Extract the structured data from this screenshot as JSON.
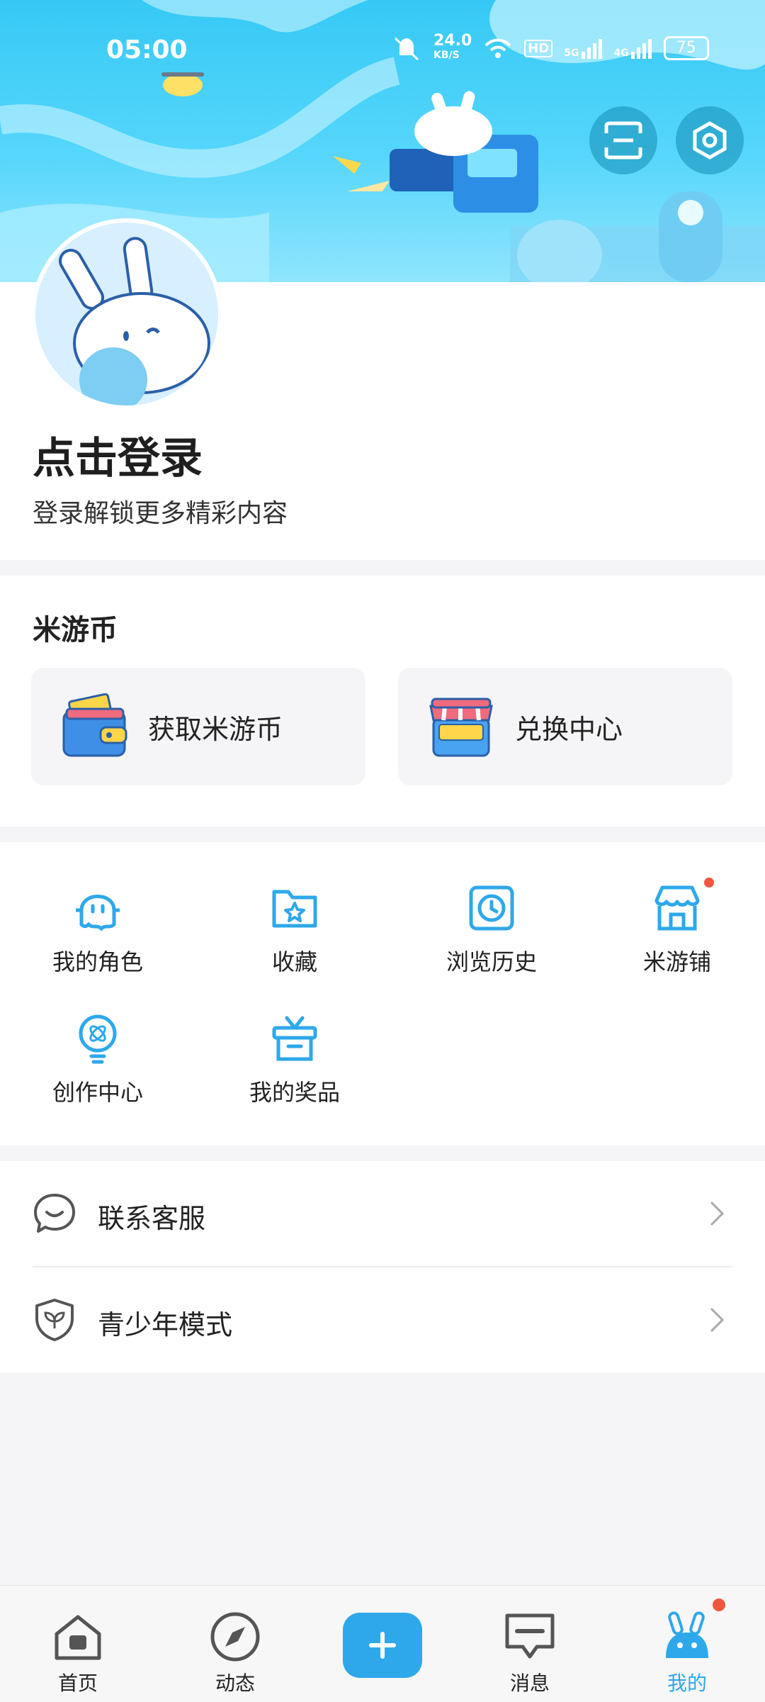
{
  "status_bar": {
    "time": "05:00",
    "net_speed": "24.0",
    "net_speed_unit": "KB/S",
    "hd_label": "HD",
    "signal_5g": "5G",
    "signal_4g": "4G",
    "battery": "75"
  },
  "profile": {
    "login_title": "点击登录",
    "login_subtitle": "登录解锁更多精彩内容"
  },
  "coin": {
    "section_title": "米游币",
    "cards": [
      {
        "label": "获取米游币",
        "icon": "wallet-icon"
      },
      {
        "label": "兑换中心",
        "icon": "shop-stall-icon"
      }
    ]
  },
  "shortcuts": [
    {
      "label": "我的角色",
      "icon": "character-icon"
    },
    {
      "label": "收藏",
      "icon": "star-folder-icon"
    },
    {
      "label": "浏览历史",
      "icon": "clock-icon"
    },
    {
      "label": "米游铺",
      "icon": "store-icon",
      "badge": true
    },
    {
      "label": "创作中心",
      "icon": "bulb-icon"
    },
    {
      "label": "我的奖品",
      "icon": "gift-icon"
    }
  ],
  "menu": [
    {
      "label": "联系客服",
      "icon": "chat-face-icon"
    },
    {
      "label": "青少年模式",
      "icon": "shield-leaf-icon"
    }
  ],
  "bottom_nav": [
    {
      "label": "首页",
      "icon": "home-icon"
    },
    {
      "label": "动态",
      "icon": "compass-icon"
    },
    {
      "label": "",
      "icon": "plus-icon"
    },
    {
      "label": "消息",
      "icon": "message-icon"
    },
    {
      "label": "我的",
      "icon": "bunny-icon",
      "active": true
    }
  ],
  "colors": {
    "accent": "#2ea8ea",
    "hero_sky": "#36c9f5",
    "badge": "#f0573f"
  }
}
